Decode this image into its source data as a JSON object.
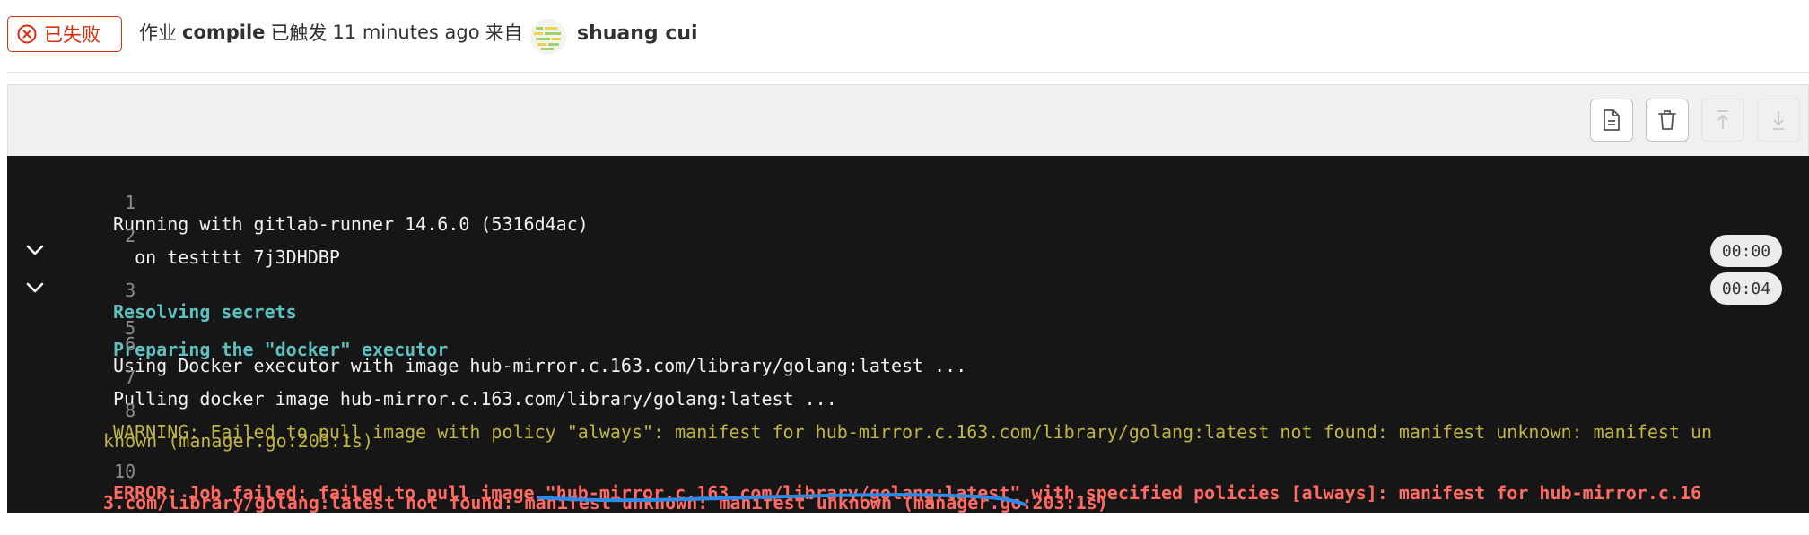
{
  "header": {
    "status_label": "已失败",
    "job_prefix": "作业",
    "job_name": "compile",
    "triggered_text": "已触发",
    "time_ago": "11 minutes ago",
    "from_text": "来自",
    "user_name": "shuang cui"
  },
  "toolbar": {
    "buttons": [
      "raw-log",
      "erase-log",
      "scroll-to-top",
      "scroll-to-bottom"
    ]
  },
  "log": {
    "lines": [
      {
        "num": "1",
        "text": "Running with gitlab-runner 14.6.0 (5316d4ac)"
      },
      {
        "num": "2",
        "text": "  on testttt 7j3DHDBP"
      },
      {
        "num": "3",
        "text": "Resolving secrets",
        "duration": "00:00"
      },
      {
        "num": "5",
        "text": "Preparing the \"docker\" executor",
        "duration": "00:04"
      },
      {
        "num": "6",
        "text": "Using Docker executor with image hub-mirror.c.163.com/library/golang:latest ..."
      },
      {
        "num": "7",
        "text": "Pulling docker image hub-mirror.c.163.com/library/golang:latest ..."
      },
      {
        "num": "8",
        "text": "WARNING: Failed to pull image with policy \"always\": manifest for hub-mirror.c.163.com/library/golang:latest not found: manifest unknown: manifest un",
        "wrap": "known (manager.go:203:1s)"
      },
      {
        "num": "10",
        "text": "ERROR: Job failed: failed to pull image \"hub-mirror.c.163.com/library/golang:latest\" with specified policies [always]: manifest for hub-mirror.c.16",
        "wrap": "3.com/library/golang:latest not found: manifest unknown: manifest unknown (manager.go:203:1s)"
      }
    ]
  },
  "colors": {
    "failed": "#dd2b0e",
    "log_bg": "#161616",
    "section": "#5fc0c0",
    "warning": "#c0b544",
    "error": "#ff6a63",
    "annotation": "#2a8be8"
  }
}
